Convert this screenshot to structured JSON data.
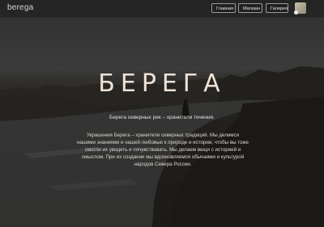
{
  "header": {
    "brand": "berega",
    "nav": [
      {
        "label": "Главная"
      },
      {
        "label": "Магазин"
      },
      {
        "label": "Галерея"
      }
    ]
  },
  "hero": {
    "title": "БЕРЕГА",
    "tagline": "Берега северных рек – хранители течения.",
    "description": "Украшения Берега – хранители северных традиций. Мы делимся нашими знаниями и нашей любовью к природе и истории, чтобы вы тоже смогли их увидеть и почувствовать. Мы делаем вещи с историей и смыслом. При их создании мы вдохновляемся обычаями и культурой народов Севера России."
  },
  "colors": {
    "title": "#ede2d3",
    "background": "#2a2a2a"
  }
}
